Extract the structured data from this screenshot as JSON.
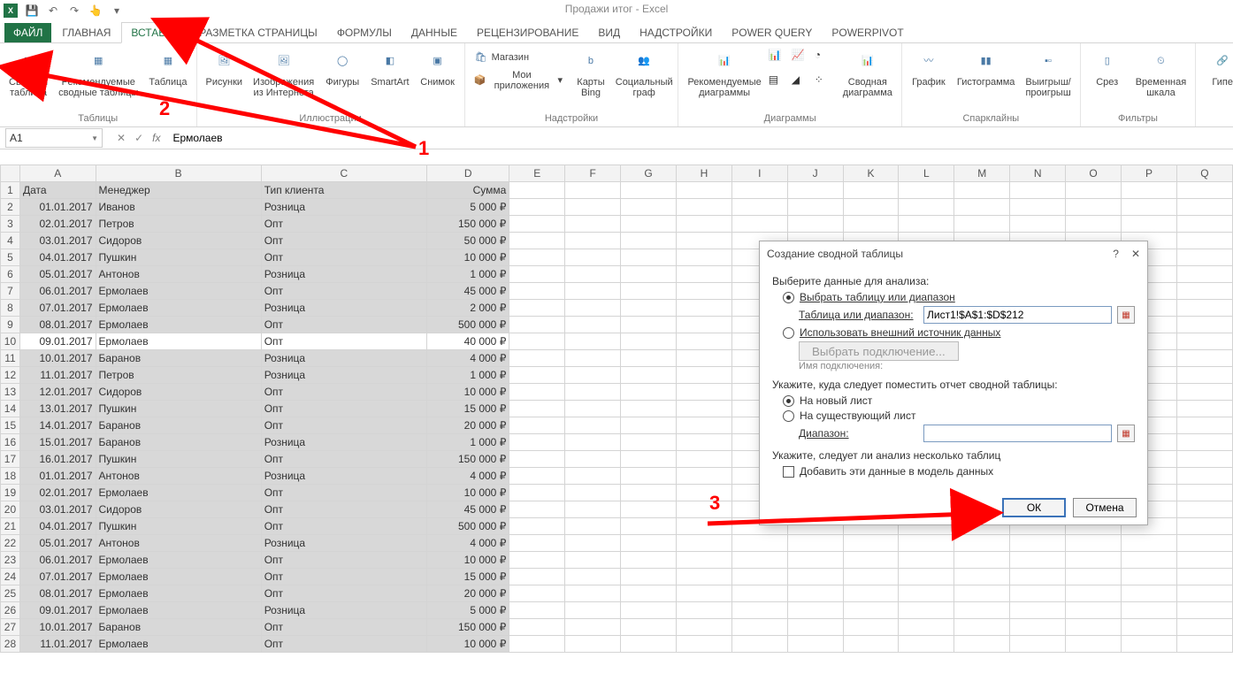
{
  "app_title": "Продажи итог - Excel",
  "qat": {
    "save": "💾",
    "undo": "↶",
    "redo": "↷",
    "touch": "👆"
  },
  "tabs": {
    "file": "ФАЙЛ",
    "home": "ГЛАВНАЯ",
    "insert": "ВСТАВКА",
    "layout": "РАЗМЕТКА СТРАНИЦЫ",
    "formulas": "ФОРМУЛЫ",
    "data": "ДАННЫЕ",
    "review": "РЕЦЕНЗИРОВАНИЕ",
    "view": "ВИД",
    "addins": "НАДСТРОЙКИ",
    "powerquery": "POWER QUERY",
    "powerpivot": "POWERPIVOT"
  },
  "ribbon": {
    "g_tables": {
      "label": "Таблицы",
      "pivot": "Сводная\nтаблица",
      "recpivot": "Рекомендуемые\nсводные таблицы",
      "table": "Таблица"
    },
    "g_illus": {
      "label": "Иллюстрации",
      "pic": "Рисунки",
      "online": "Изображения\nиз Интернета",
      "shapes": "Фигуры",
      "smartart": "SmartArt",
      "screenshot": "Снимок"
    },
    "g_addins": {
      "label": "Надстройки",
      "store": "Магазин",
      "myapps": "Мои приложения",
      "bing": "Карты\nBing",
      "people": "Социальный\nграф"
    },
    "g_charts": {
      "label": "Диаграммы",
      "rec": "Рекомендуемые\nдиаграммы",
      "pivotchart": "Сводная\nдиаграмма"
    },
    "g_spark": {
      "label": "Спарклайны",
      "line": "График",
      "col": "Гистограмма",
      "winloss": "Выигрыш/\nпроигрыш"
    },
    "g_filters": {
      "label": "Фильтры",
      "slicer": "Срез",
      "timeline": "Временная\nшкала"
    },
    "g_links": {
      "hyperlink": "Гипе"
    }
  },
  "namebox": "A1",
  "formula": "Ермолаев",
  "headers": {
    "a": "Дата",
    "b": "Менеджер",
    "c": "Тип клиента",
    "d": "Сумма"
  },
  "cols_rest": [
    "E",
    "F",
    "G",
    "H",
    "I",
    "J",
    "K",
    "L",
    "M",
    "N",
    "O",
    "P",
    "Q"
  ],
  "rows": [
    {
      "r": 2,
      "a": "01.01.2017",
      "b": "Иванов",
      "c": "Розница",
      "d": "5 000 ₽"
    },
    {
      "r": 3,
      "a": "02.01.2017",
      "b": "Петров",
      "c": "Опт",
      "d": "150 000 ₽"
    },
    {
      "r": 4,
      "a": "03.01.2017",
      "b": "Сидоров",
      "c": "Опт",
      "d": "50 000 ₽"
    },
    {
      "r": 5,
      "a": "04.01.2017",
      "b": "Пушкин",
      "c": "Опт",
      "d": "10 000 ₽"
    },
    {
      "r": 6,
      "a": "05.01.2017",
      "b": "Антонов",
      "c": "Розница",
      "d": "1 000 ₽"
    },
    {
      "r": 7,
      "a": "06.01.2017",
      "b": "Ермолаев",
      "c": "Опт",
      "d": "45 000 ₽"
    },
    {
      "r": 8,
      "a": "07.01.2017",
      "b": "Ермолаев",
      "c": "Розница",
      "d": "2 000 ₽"
    },
    {
      "r": 9,
      "a": "08.01.2017",
      "b": "Ермолаев",
      "c": "Опт",
      "d": "500 000 ₽"
    },
    {
      "r": 10,
      "a": "09.01.2017",
      "b": "Ермолаев",
      "c": "Опт",
      "d": "40 000 ₽",
      "hl": true
    },
    {
      "r": 11,
      "a": "10.01.2017",
      "b": "Баранов",
      "c": "Розница",
      "d": "4 000 ₽"
    },
    {
      "r": 12,
      "a": "11.01.2017",
      "b": "Петров",
      "c": "Розница",
      "d": "1 000 ₽"
    },
    {
      "r": 13,
      "a": "12.01.2017",
      "b": "Сидоров",
      "c": "Опт",
      "d": "10 000 ₽"
    },
    {
      "r": 14,
      "a": "13.01.2017",
      "b": "Пушкин",
      "c": "Опт",
      "d": "15 000 ₽"
    },
    {
      "r": 15,
      "a": "14.01.2017",
      "b": "Баранов",
      "c": "Опт",
      "d": "20 000 ₽"
    },
    {
      "r": 16,
      "a": "15.01.2017",
      "b": "Баранов",
      "c": "Розница",
      "d": "1 000 ₽"
    },
    {
      "r": 17,
      "a": "16.01.2017",
      "b": "Пушкин",
      "c": "Опт",
      "d": "150 000 ₽"
    },
    {
      "r": 18,
      "a": "01.01.2017",
      "b": "Антонов",
      "c": "Розница",
      "d": "4 000 ₽"
    },
    {
      "r": 19,
      "a": "02.01.2017",
      "b": "Ермолаев",
      "c": "Опт",
      "d": "10 000 ₽"
    },
    {
      "r": 20,
      "a": "03.01.2017",
      "b": "Сидоров",
      "c": "Опт",
      "d": "45 000 ₽"
    },
    {
      "r": 21,
      "a": "04.01.2017",
      "b": "Пушкин",
      "c": "Опт",
      "d": "500 000 ₽"
    },
    {
      "r": 22,
      "a": "05.01.2017",
      "b": "Антонов",
      "c": "Розница",
      "d": "4 000 ₽"
    },
    {
      "r": 23,
      "a": "06.01.2017",
      "b": "Ермолаев",
      "c": "Опт",
      "d": "10 000 ₽"
    },
    {
      "r": 24,
      "a": "07.01.2017",
      "b": "Ермолаев",
      "c": "Опт",
      "d": "15 000 ₽"
    },
    {
      "r": 25,
      "a": "08.01.2017",
      "b": "Ермолаев",
      "c": "Опт",
      "d": "20 000 ₽"
    },
    {
      "r": 26,
      "a": "09.01.2017",
      "b": "Ермолаев",
      "c": "Розница",
      "d": "5 000 ₽"
    },
    {
      "r": 27,
      "a": "10.01.2017",
      "b": "Баранов",
      "c": "Опт",
      "d": "150 000 ₽"
    },
    {
      "r": 28,
      "a": "11.01.2017",
      "b": "Ермолаев",
      "c": "Опт",
      "d": "10 000 ₽"
    }
  ],
  "dialog": {
    "title": "Создание сводной таблицы",
    "select_data": "Выберите данные для анализа:",
    "opt_range": "Выбрать таблицу или диапазон",
    "range_label": "Таблица или диапазон:",
    "range_value": "Лист1!$A$1:$D$212",
    "opt_external": "Использовать внешний источник данных",
    "choose_conn": "Выбрать подключение...",
    "conn_name": "Имя подключения:",
    "place_label": "Укажите, куда следует поместить отчет сводной таблицы:",
    "opt_newsheet": "На новый лист",
    "opt_existing": "На существующий лист",
    "range2_label": "Диапазон:",
    "multi_label": "Укажите, следует ли анализ несколько таблиц",
    "chk_model": "Добавить эти данные в модель данных",
    "ok": "ОК",
    "cancel": "Отмена"
  },
  "ann": {
    "n1": "1",
    "n2": "2",
    "n3": "3"
  }
}
